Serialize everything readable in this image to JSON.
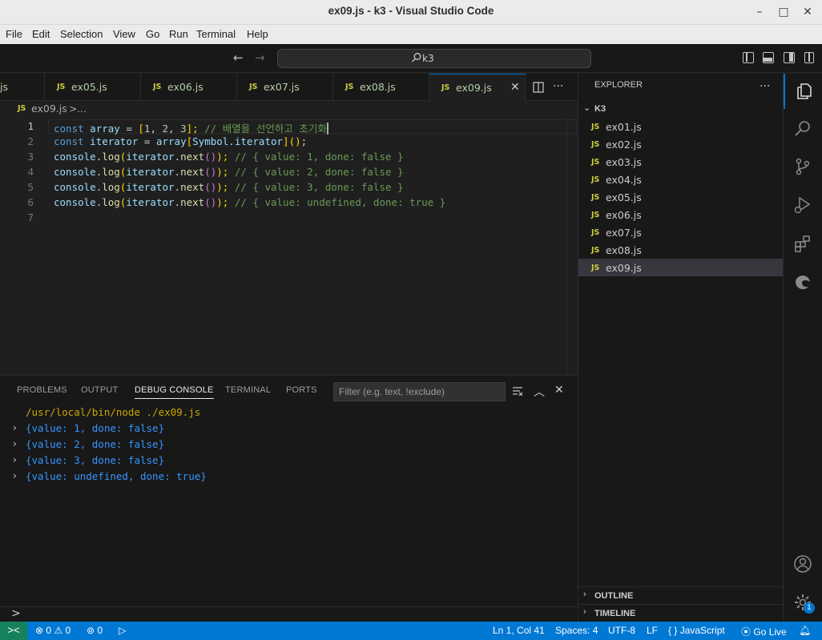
{
  "window": {
    "title": "ex09.js - k3 - Visual Studio Code",
    "controls": [
      "minimize",
      "maximize",
      "close"
    ]
  },
  "menu": [
    "File",
    "Edit",
    "Selection",
    "View",
    "Go",
    "Run",
    "Terminal",
    "Help"
  ],
  "command_center": {
    "label": "k3"
  },
  "tabs": [
    {
      "label": "js",
      "active": false
    },
    {
      "label": "ex05.js",
      "icon": "JS",
      "active": false
    },
    {
      "label": "ex06.js",
      "icon": "JS",
      "active": false
    },
    {
      "label": "ex07.js",
      "icon": "JS",
      "active": false
    },
    {
      "label": "ex08.js",
      "icon": "JS",
      "active": false
    },
    {
      "label": "ex09.js",
      "icon": "JS",
      "active": true
    }
  ],
  "breadcrumb": {
    "icon": "JS",
    "file": "ex09.js",
    "sep": ">",
    "more": "..."
  },
  "editor": {
    "line_numbers": [
      "1",
      "2",
      "3",
      "4",
      "5",
      "6",
      "7"
    ],
    "lines": [
      [
        "const",
        "array",
        " = ",
        "[",
        "1",
        ", ",
        "2",
        ", ",
        "3",
        "];",
        " // 배열을 선언하고 초기화"
      ],
      [
        "const",
        "iterator",
        " = ",
        "array",
        "[",
        "Symbol",
        ".",
        "iterator",
        "]",
        "()",
        ";"
      ],
      [
        "console",
        ".",
        "log",
        "(",
        "iterator",
        ".",
        "next",
        "()",
        ");",
        " // { value: 1, done: false }"
      ],
      [
        "console",
        ".",
        "log",
        "(",
        "iterator",
        ".",
        "next",
        "()",
        ");",
        " // { value: 2, done: false }"
      ],
      [
        "console",
        ".",
        "log",
        "(",
        "iterator",
        ".",
        "next",
        "()",
        ");",
        " // { value: 3, done: false }"
      ],
      [
        "console",
        ".",
        "log",
        "(",
        "iterator",
        ".",
        "next",
        "()",
        ");",
        " // { value: undefined, done: true }"
      ]
    ]
  },
  "panel": {
    "tabs": [
      "PROBLEMS",
      "OUTPUT",
      "DEBUG CONSOLE",
      "TERMINAL",
      "PORTS"
    ],
    "active_tab": "DEBUG CONSOLE",
    "filter_placeholder": "Filter (e.g. text, !exclude)",
    "console": {
      "path": "/usr/local/bin/node ./ex09.js",
      "outputs": [
        "{value: 1, done: false}",
        "{value: 2, done: false}",
        "{value: 3, done: false}",
        "{value: undefined, done: true}"
      ],
      "prompt": ">"
    }
  },
  "explorer": {
    "header": "EXPLORER",
    "more": "...",
    "folder": "K3",
    "files": [
      "ex01.js",
      "ex02.js",
      "ex03.js",
      "ex04.js",
      "ex05.js",
      "ex06.js",
      "ex07.js",
      "ex08.js",
      "ex09.js"
    ],
    "selected": "ex09.js",
    "file_icon": "JS",
    "sections": [
      "OUTLINE",
      "TIMELINE"
    ]
  },
  "activity_bar": {
    "items": [
      "explorer-icon",
      "search-icon",
      "source-control-icon",
      "run-debug-icon",
      "extensions-icon",
      "edge-icon"
    ],
    "bottom": [
      "account-icon",
      "manage-gear-icon"
    ],
    "manage_badge": "1"
  },
  "status_bar": {
    "remote": "><",
    "errors": "0",
    "warnings": "0",
    "ports": "0",
    "position": "Ln 1, Col 41",
    "spaces": "Spaces: 4",
    "encoding": "UTF-8",
    "eol": "LF",
    "language_icon": "{ }",
    "language": "JavaScript",
    "go_live": "Go Live"
  },
  "colors": {
    "accent": "#0078d4",
    "editor_bg": "#1f1f1f",
    "sidebar_bg": "#181818",
    "js_icon": "#cbcb41",
    "keyword": "#569cd6",
    "comment": "#6a9955"
  }
}
